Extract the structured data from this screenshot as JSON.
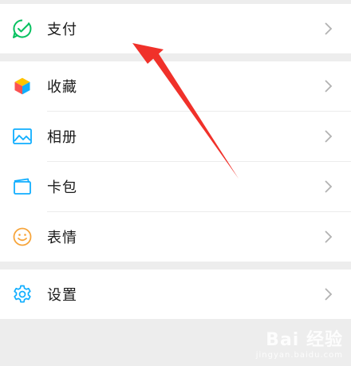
{
  "groups": [
    {
      "items": [
        {
          "label": "支付",
          "icon": "pay-check-icon"
        }
      ]
    },
    {
      "items": [
        {
          "label": "收藏",
          "icon": "favorites-cube-icon"
        },
        {
          "label": "相册",
          "icon": "album-picture-icon"
        },
        {
          "label": "卡包",
          "icon": "card-wallet-icon"
        },
        {
          "label": "表情",
          "icon": "emoji-smile-icon"
        }
      ]
    },
    {
      "items": [
        {
          "label": "设置",
          "icon": "settings-gear-icon"
        }
      ]
    }
  ],
  "colors": {
    "pay_green": "#07c160",
    "icon_blue": "#10aeff",
    "emoji_orange": "#f7a53b",
    "annotation_red": "#f0312a",
    "chevron_gray": "#b2b2b2"
  },
  "watermark": {
    "main": "Bai 经验",
    "sub": "jingyan.baidu.com"
  }
}
